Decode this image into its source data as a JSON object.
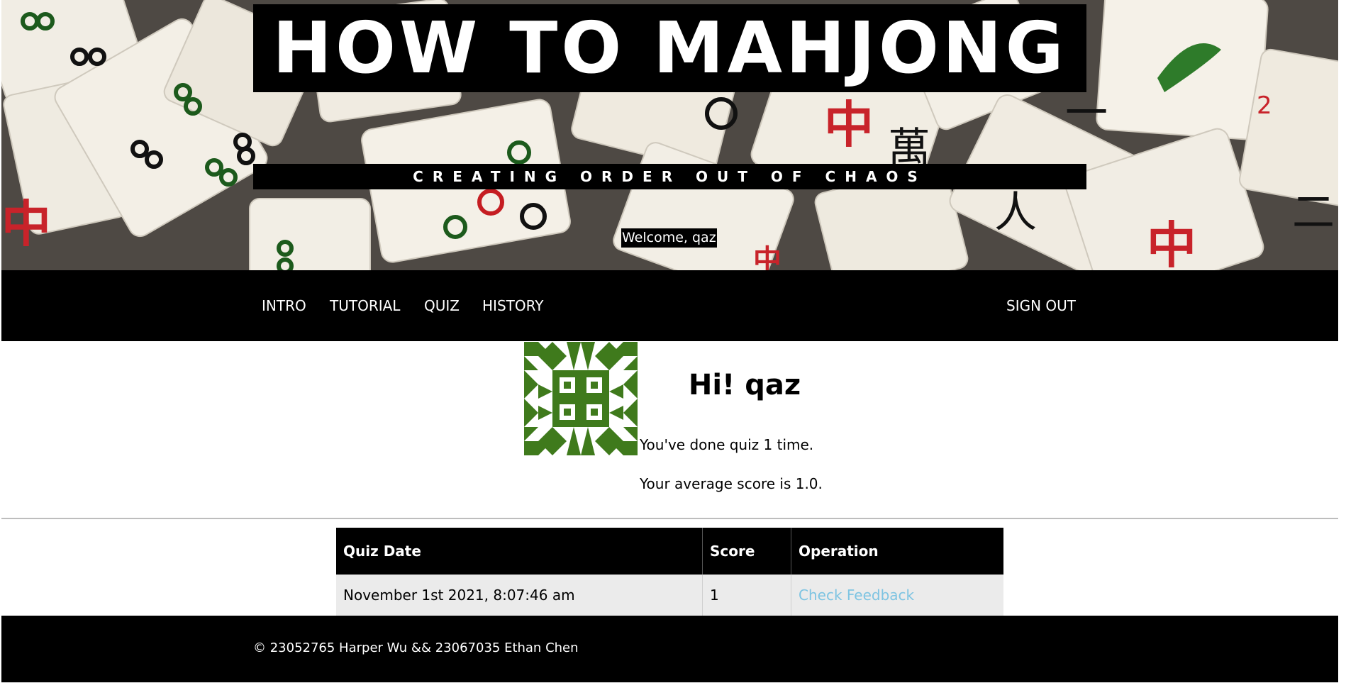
{
  "header": {
    "title": "HOW TO MAHJONG",
    "subtitle": "CREATING ORDER OUT OF CHAOS",
    "welcome": "Welcome, qaz"
  },
  "nav": {
    "items": [
      {
        "label": "INTRO"
      },
      {
        "label": "TUTORIAL"
      },
      {
        "label": "QUIZ"
      },
      {
        "label": "HISTORY"
      }
    ],
    "sign_out": "SIGN OUT"
  },
  "profile": {
    "greeting": "Hi! qaz",
    "quiz_count_text": "You've done quiz 1 time.",
    "average_text": "Your average score is 1.0.",
    "avatar_color": "#3f7a1c"
  },
  "history_table": {
    "headers": [
      "Quiz Date",
      "Score",
      "Operation"
    ],
    "rows": [
      {
        "date": "November 1st 2021, 8:07:46 am",
        "score": "1",
        "operation": "Check Feedback"
      }
    ]
  },
  "footer": {
    "text": "© 23052765 Harper Wu && 23067035 Ethan Chen"
  },
  "colors": {
    "link": "#7ec4e2",
    "bar": "#000000",
    "row_bg": "#ebebeb"
  }
}
